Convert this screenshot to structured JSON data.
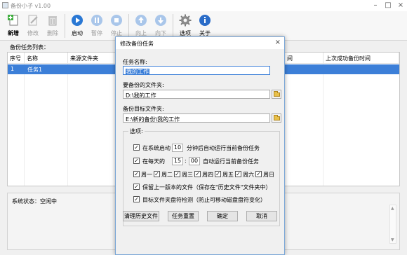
{
  "window": {
    "title": "备份小子 v1.00"
  },
  "toolbar": [
    {
      "label": "新增",
      "icon": "plus-doc-icon",
      "enabled": true
    },
    {
      "label": "修改",
      "icon": "edit-icon",
      "enabled": false
    },
    {
      "label": "删除",
      "icon": "trash-icon",
      "enabled": false
    },
    {
      "label": "启动",
      "icon": "play-icon",
      "enabled": true
    },
    {
      "label": "暂停",
      "icon": "pause-icon",
      "enabled": false
    },
    {
      "label": "停止",
      "icon": "stop-icon",
      "enabled": false
    },
    {
      "label": "向上",
      "icon": "arrow-up-icon",
      "enabled": false
    },
    {
      "label": "向下",
      "icon": "arrow-down-icon",
      "enabled": false
    },
    {
      "label": "选项",
      "icon": "gear-icon",
      "enabled": true
    },
    {
      "label": "关于",
      "icon": "info-icon",
      "enabled": true
    }
  ],
  "tasklist": {
    "label": "备份任务列表：",
    "columns": [
      "序号",
      "名称",
      "来源文件夹",
      "间",
      "上次成功备份时间"
    ],
    "rows": [
      {
        "index": "1",
        "name": "任务1"
      }
    ]
  },
  "status": {
    "label": "系统状态：空闲中"
  },
  "dialog": {
    "title": "修改备份任务",
    "name_label": "任务名称:",
    "name_value": "我的工作",
    "source_label": "要备份的文件夹:",
    "source_value": "D:\\我的工作",
    "target_label": "备份目标文件夹:",
    "target_value": "E:\\新的备份\\我的工作",
    "options": {
      "legend": "选项:",
      "startup_pre": "在系统启动",
      "startup_minutes": "10",
      "startup_post": "分钟后自动运行当前备份任务",
      "daily_pre": "在每天的",
      "daily_hour": "15",
      "daily_colon": ":",
      "daily_minute": "00",
      "daily_post": "自动运行当前备份任务",
      "weekdays": [
        "周一",
        "周二",
        "周三",
        "周四",
        "周五",
        "周六",
        "周日"
      ],
      "keep_history": "保留上一版本的文件（保存在\"历史文件\"文件夹中）",
      "drive_detect": "目标文件夹盘符检测（防止可移动磁盘盘符变化）"
    },
    "buttons": {
      "clear_history": "清理历史文件",
      "reset_task": "任务重置",
      "ok": "确定",
      "cancel": "取消"
    }
  },
  "colors": {
    "accent": "#3c7fd8",
    "play": "#2a78d4",
    "folder": "#e8c04a"
  }
}
